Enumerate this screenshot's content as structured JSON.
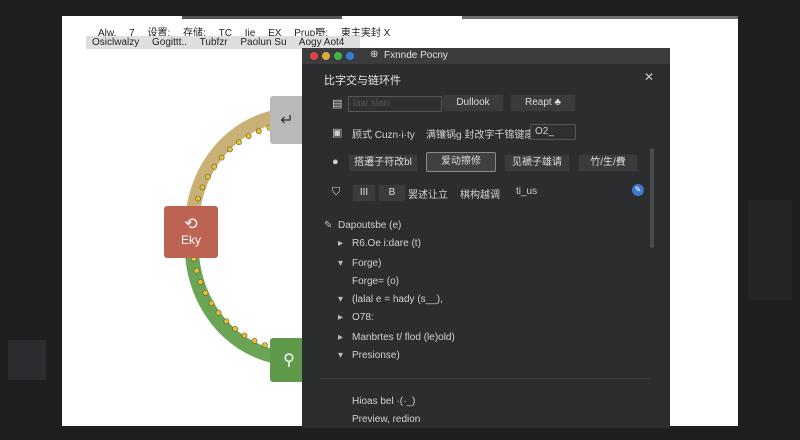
{
  "menu_row1": [
    "Alw,",
    "7",
    "设置:",
    "存储:",
    "TC",
    "Ije",
    "EX",
    "Pruᴅ嘢:",
    "東主実封 X"
  ],
  "menu_row2": [
    "Osiclwalzy",
    "Gogittt..",
    "Tubfzr",
    "Paolun Su",
    "Aogy Aot4"
  ],
  "diagram": {
    "left_node_label": "Eky",
    "top_node_icon": "return-icon",
    "left_node_icon": "refresh-icon",
    "bottom_node_icon": "search-icon",
    "arc_colors": {
      "top": "#c9b077",
      "bottom": "#6aa455",
      "dots": "#e0c23a"
    }
  },
  "window": {
    "title": "Fxnnde Pocny",
    "pane_title": "比字交与链环件",
    "row1": {
      "field": "law slan",
      "button1": "Dullook",
      "button2": "Reapt ♣"
    },
    "row2": {
      "label": "顾式 Cuzn·i·ty",
      "text": "满镶锅g 封改字千锦键康",
      "field": "O2_"
    },
    "row3": {
      "tab1": "搭遷子符改bl",
      "tab2": "爱动擦修",
      "tab3": "见褫子雄请",
      "tab4": "竹/生/費"
    },
    "row4": {
      "b1": "III",
      "b2": "B",
      "b3": "罢述让立",
      "b4": "棋构越调",
      "b5": "ti_us"
    },
    "tree": [
      {
        "bullet": "✎",
        "text": "Dapoutsbe (e)"
      },
      {
        "bullet": "▸",
        "text": "R6.Oe i:dare (t)"
      },
      {
        "bullet": "▾",
        "text": "Forge)"
      },
      {
        "bullet": "",
        "text": "Forge= (o)"
      },
      {
        "bullet": "▾",
        "text": "(lalal e   = hady (s__),"
      },
      {
        "bullet": "▸",
        "text": "O78:"
      },
      {
        "bullet": "▸",
        "text": "Manbrtes t/ flod (le)old)"
      },
      {
        "bullet": "▾",
        "text": "Presionse)"
      }
    ],
    "footer1": "Hioas bel ·(·_)",
    "footer2": "Preview, redion"
  }
}
